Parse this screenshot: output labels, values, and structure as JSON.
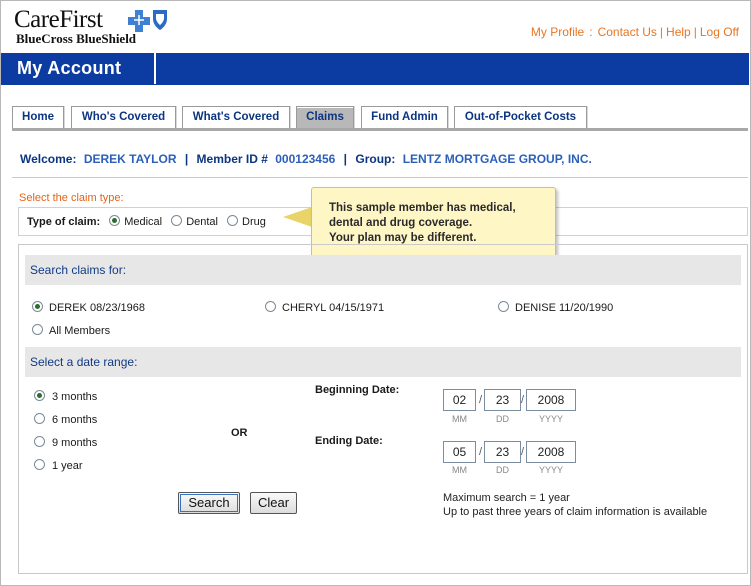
{
  "logo": {
    "main": "CareFirst",
    "sub": "BlueCross BlueShield",
    "mark_colors": {
      "cross": "#3f7fd4",
      "shield": "#2b6bc4"
    }
  },
  "top_nav": {
    "links": [
      "My Profile",
      "Contact Us",
      "Help",
      "Log Off"
    ],
    "separators": [
      ":",
      "|",
      "|"
    ],
    "color": "#e87522"
  },
  "banner": {
    "title": "My Account",
    "color": "#0c3ba1"
  },
  "tabs": [
    {
      "label": "Home",
      "active": false
    },
    {
      "label": "Who's Covered",
      "active": false
    },
    {
      "label": "What's Covered",
      "active": false
    },
    {
      "label": "Claims",
      "active": true
    },
    {
      "label": "Fund Admin",
      "active": false
    },
    {
      "label": "Out-of-Pocket Costs",
      "active": false
    }
  ],
  "welcome": {
    "welcome_label": "Welcome:",
    "name": "DEREK TAYLOR",
    "member_label": "Member ID #",
    "member_id": "000123456",
    "group_label": "Group:",
    "group": "LENTZ MORTGAGE GROUP, INC."
  },
  "claim_type": {
    "heading": "Select the claim type:",
    "label": "Type of claim:",
    "options": [
      {
        "label": "Medical",
        "checked": true
      },
      {
        "label": "Dental",
        "checked": false
      },
      {
        "label": "Drug",
        "checked": false
      }
    ]
  },
  "tooltip": {
    "lines": [
      "This sample member has medical,",
      "dental and drug coverage.",
      "Your plan may be different."
    ]
  },
  "search_for": {
    "heading": "Search claims for:",
    "members": [
      {
        "label": "DEREK 08/23/1968",
        "checked": true
      },
      {
        "label": "CHERYL 04/15/1971",
        "checked": false
      },
      {
        "label": "DENISE 11/20/1990",
        "checked": false
      },
      {
        "label": "All Members",
        "checked": false
      }
    ]
  },
  "date_range": {
    "heading": "Select a date range:",
    "ranges": [
      {
        "label": "3 months",
        "checked": true
      },
      {
        "label": "6 months",
        "checked": false
      },
      {
        "label": "9 months",
        "checked": false
      },
      {
        "label": "1 year",
        "checked": false
      }
    ],
    "or_label": "OR",
    "beginning": {
      "label": "Beginning Date:",
      "mm": "02",
      "dd": "23",
      "yyyy": "2008"
    },
    "ending": {
      "label": "Ending Date:",
      "mm": "05",
      "dd": "23",
      "yyyy": "2008"
    },
    "hints": {
      "mm": "MM",
      "dd": "DD",
      "yyyy": "YYYY"
    },
    "slash": "/"
  },
  "buttons": {
    "search": "Search",
    "clear": "Clear"
  },
  "notes": [
    "Maximum search = 1 year",
    "Up to past three years of claim information is available"
  ]
}
